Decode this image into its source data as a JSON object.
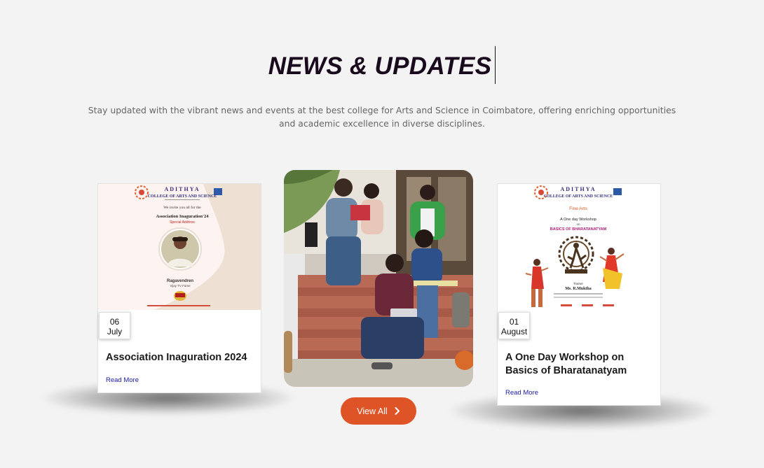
{
  "section": {
    "title": "NEWS & UPDATES",
    "intro": "Stay updated with the vibrant news and events at the best college for Arts and Science in Coimbatore, offering enriching opportunities and academic excellence in diverse disciplines."
  },
  "cards": [
    {
      "day": "06",
      "month": "July",
      "title": "Association Inaguration 2024",
      "read_more": "Read More",
      "poster": {
        "college": "ADITHYA",
        "college_sub": "COLLEGE OF ARTS AND SCIENCE",
        "invite": "We invite you all for the",
        "event": "Association Inaguration'24",
        "role": "Special Address",
        "guest": "Ragavendren",
        "guest_role": "Vijay TV Fame"
      }
    },
    {
      "day": "01",
      "month": "August",
      "title": "A One Day Workshop on Basics of Bharatanatyam",
      "read_more": "Read More",
      "poster": {
        "college": "ADITHYA",
        "college_sub": "COLLEGE OF ARTS AND SCIENCE",
        "dept": "Fine Arts",
        "event": "A One day Workshop",
        "on": "on",
        "topic": "BASICS OF BHARATANATYAM",
        "trainer_label": "Trainer",
        "trainer": "Ms. R.Muktha"
      }
    }
  ],
  "view_all": {
    "label": "View All",
    "icon": "chevron-right-icon"
  },
  "colors": {
    "accent": "#de5426",
    "heading": "#1a0a1e",
    "link": "#1a1aa6"
  }
}
